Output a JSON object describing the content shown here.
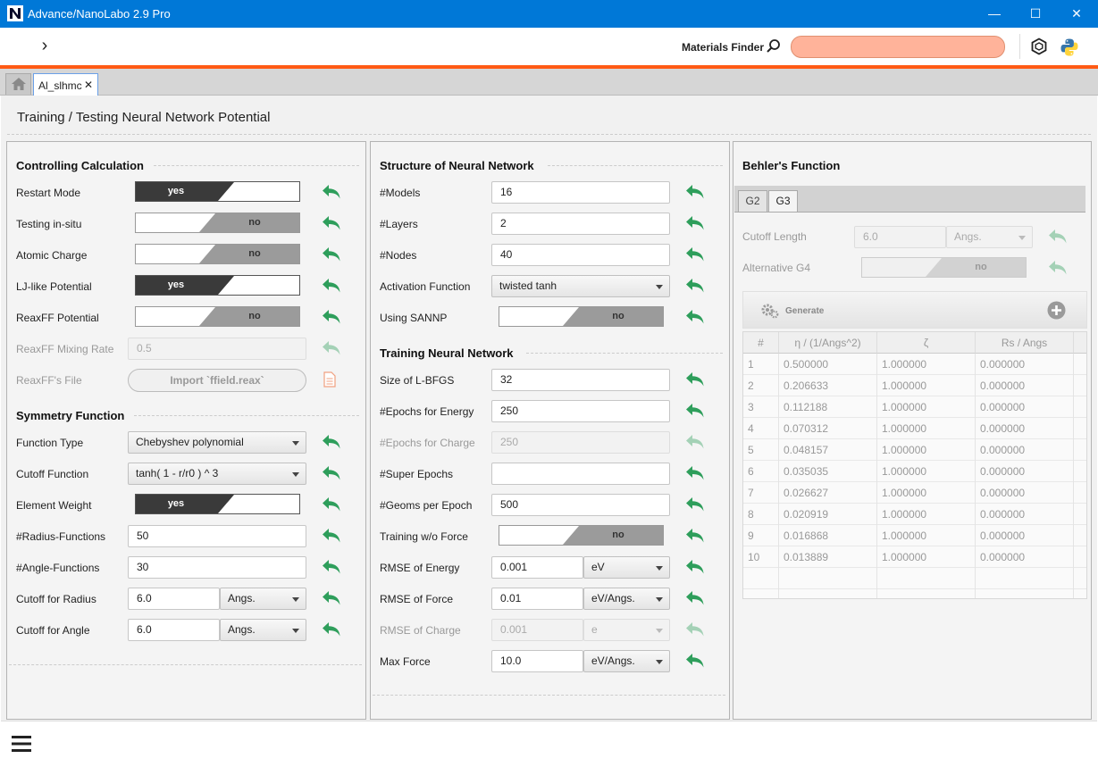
{
  "window": {
    "title": "Advance/NanoLabo 2.9 Pro",
    "minimize": "—",
    "maximize": "☐",
    "close": "✕"
  },
  "toolbar": {
    "expand": "›",
    "materials_finder_label": "Materials Finder",
    "search_value": ""
  },
  "tabs": {
    "doc_tab_label": "Al_slhmc",
    "doc_tab_close": "✕"
  },
  "page": {
    "title": "Training / Testing Neural Network Potential"
  },
  "controlling": {
    "title": "Controlling Calculation",
    "restart_mode": {
      "label": "Restart Mode",
      "value": "yes"
    },
    "testing_insitu": {
      "label": "Testing in-situ",
      "value": "no"
    },
    "atomic_charge": {
      "label": "Atomic Charge",
      "value": "no"
    },
    "lj_like": {
      "label": "LJ-like Potential",
      "value": "yes"
    },
    "reaxff_potential": {
      "label": "ReaxFF Potential",
      "value": "no"
    },
    "reaxff_mixing": {
      "label": "ReaxFF Mixing Rate",
      "value": "0.5"
    },
    "reaxff_file": {
      "label": "ReaxFF's File",
      "button": "Import `ffield.reax`"
    }
  },
  "symmetry": {
    "title": "Symmetry Function",
    "function_type": {
      "label": "Function Type",
      "value": "Chebyshev polynomial"
    },
    "cutoff_function": {
      "label": "Cutoff Function",
      "value": "tanh( 1 - r/r0 ) ^ 3"
    },
    "element_weight": {
      "label": "Element Weight",
      "value": "yes"
    },
    "radius_functions": {
      "label": "#Radius-Functions",
      "value": "50"
    },
    "angle_functions": {
      "label": "#Angle-Functions",
      "value": "30"
    },
    "cutoff_radius": {
      "label": "Cutoff for Radius",
      "value": "6.0",
      "unit": "Angs."
    },
    "cutoff_angle": {
      "label": "Cutoff for Angle",
      "value": "6.0",
      "unit": "Angs."
    }
  },
  "structure": {
    "title": "Structure of Neural Network",
    "models": {
      "label": "#Models",
      "value": "16"
    },
    "layers": {
      "label": "#Layers",
      "value": "2"
    },
    "nodes": {
      "label": "#Nodes",
      "value": "40"
    },
    "activation": {
      "label": "Activation Function",
      "value": "twisted tanh"
    },
    "sannp": {
      "label": "Using SANNP",
      "value": "no"
    }
  },
  "training": {
    "title": "Training Neural Network",
    "lbfgs": {
      "label": "Size of L-BFGS",
      "value": "32"
    },
    "epochs_energy": {
      "label": "#Epochs for Energy",
      "value": "250"
    },
    "epochs_charge": {
      "label": "#Epochs for Charge",
      "value": "250"
    },
    "super_epochs": {
      "label": "#Super Epochs",
      "value": ""
    },
    "geoms_per_epoch": {
      "label": "#Geoms per Epoch",
      "value": "500"
    },
    "without_force": {
      "label": "Training w/o Force",
      "value": "no"
    },
    "rmse_energy": {
      "label": "RMSE of Energy",
      "value": "0.001",
      "unit": "eV"
    },
    "rmse_force": {
      "label": "RMSE of Force",
      "value": "0.01",
      "unit": "eV/Angs."
    },
    "rmse_charge": {
      "label": "RMSE of Charge",
      "value": "0.001",
      "unit": "e"
    },
    "max_force": {
      "label": "Max Force",
      "value": "10.0",
      "unit": "eV/Angs."
    }
  },
  "behler": {
    "title": "Behler's Function",
    "tabs": [
      "G2",
      "G3"
    ],
    "cutoff_length": {
      "label": "Cutoff Length",
      "value": "6.0",
      "unit": "Angs."
    },
    "alt_g4": {
      "label": "Alternative G4",
      "value": "no"
    },
    "generate_label": "Generate",
    "table": {
      "headers": [
        "#",
        "η / (1/Angs^2)",
        "ζ",
        "Rs / Angs"
      ],
      "rows": [
        [
          "1",
          "0.500000",
          "1.000000",
          "0.000000"
        ],
        [
          "2",
          "0.206633",
          "1.000000",
          "0.000000"
        ],
        [
          "3",
          "0.112188",
          "1.000000",
          "0.000000"
        ],
        [
          "4",
          "0.070312",
          "1.000000",
          "0.000000"
        ],
        [
          "5",
          "0.048157",
          "1.000000",
          "0.000000"
        ],
        [
          "6",
          "0.035035",
          "1.000000",
          "0.000000"
        ],
        [
          "7",
          "0.026627",
          "1.000000",
          "0.000000"
        ],
        [
          "8",
          "0.020919",
          "1.000000",
          "0.000000"
        ],
        [
          "9",
          "0.016868",
          "1.000000",
          "0.000000"
        ],
        [
          "10",
          "0.013889",
          "1.000000",
          "0.000000"
        ]
      ]
    }
  },
  "colors": {
    "titlebar": "#0078d7",
    "accent_bar": "#ff5a14",
    "search_fill": "#ffb39a",
    "undo_green": "#2e9e5b"
  }
}
